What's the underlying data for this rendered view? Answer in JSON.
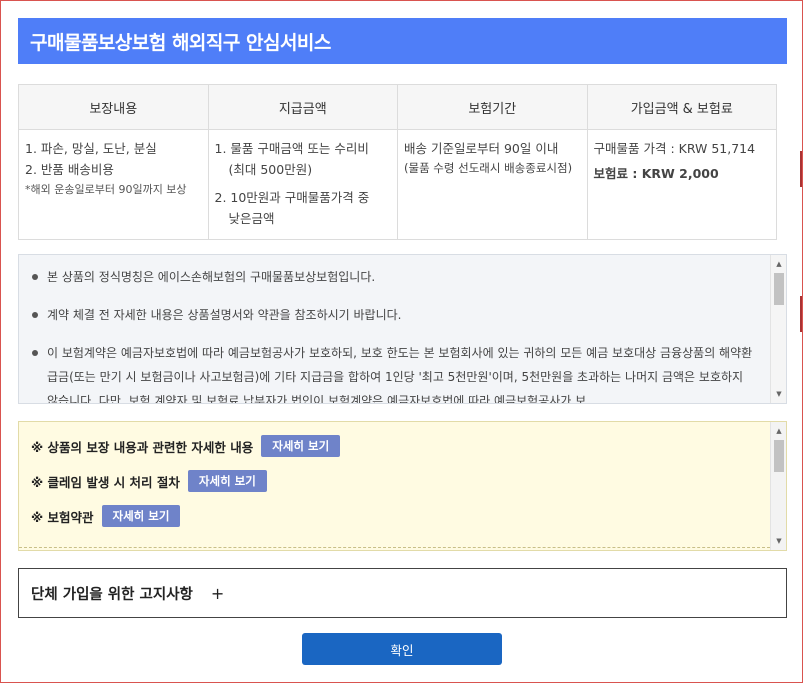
{
  "title": "구매물품보상보험 해외직구 안심서비스",
  "coverage_table": {
    "headers": [
      "보장내용",
      "지급금액",
      "보험기간",
      "가입금액 & 보험료"
    ],
    "coverage": {
      "items": [
        "1. 파손, 망실, 도난, 분실",
        "2. 반품 배송비용"
      ],
      "note": "*해외 운송일로부터 90일까지 보상"
    },
    "payment": {
      "item1": "1. 물품 구매금액 또는 수리비",
      "item1_sub": "(최대 500만원)",
      "item2": "2. 10만원과 구매물품가격 중",
      "item2_sub": "낮은금액"
    },
    "period": {
      "line1": "배송 기준일로부터 90일 이내",
      "line2": "(물품 수령 선도래시 배송종료시점)"
    },
    "amount": {
      "price_label": "구매물품 가격 : KRW 51,714",
      "premium_prefix": "보험료 :",
      "premium_value": " KRW 2,000"
    }
  },
  "notices": [
    "본 상품의 정식명칭은 에이스손해보험의 구매물품보상보험입니다.",
    "계약 체결 전 자세한 내용은 상품설명서와 약관을 참조하시기 바랍니다.",
    "이 보험계약은 예금자보호법에 따라 예금보험공사가 보호하되, 보호 한도는 본 보험회사에 있는 귀하의 모든 예금 보호대상 금융상품의 해약환급금(또는 만기 시 보험금이나 사고보험금)에 기타 지급금을 합하여 1인당 '최고 5천만원'이며, 5천만원을 초과하는 나머지 금액은 보호하지 않습니다. 다만, 보험 계약자 및 보험료 납부자가 법인이 보험계약은 예금자보호법에 따라 예금보험공사가 보"
  ],
  "links": [
    {
      "label": "※ 상품의 보장 내용과 관련한 자세한 내용",
      "button": "자세히 보기"
    },
    {
      "label": "※ 클레임 발생 시 처리 절차",
      "button": "자세히 보기"
    },
    {
      "label": "※ 보험약관",
      "button": "자세히 보기"
    }
  ],
  "group_notice": {
    "label": "단체 가입을 위한 고지사항",
    "toggle": "+"
  },
  "confirm_label": "확인"
}
